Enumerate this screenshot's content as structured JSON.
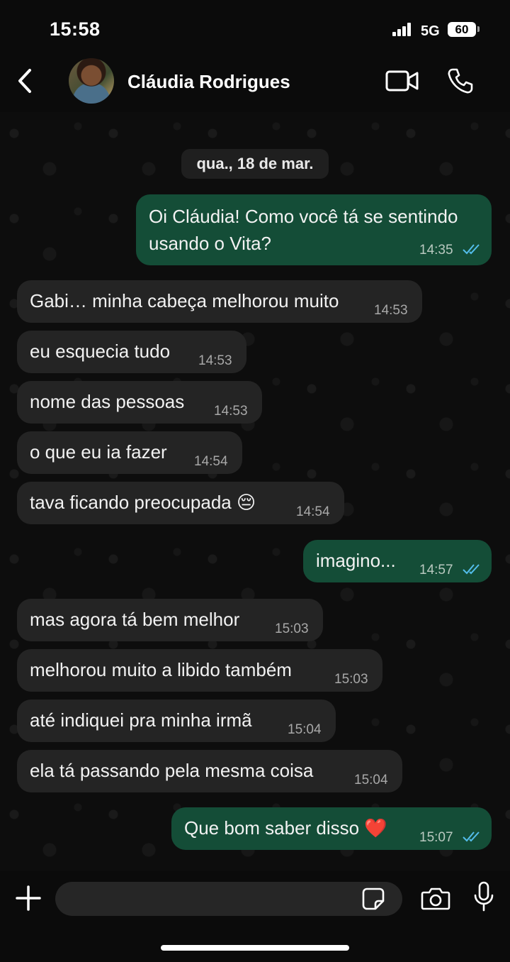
{
  "status": {
    "time": "15:58",
    "network": "5G",
    "battery": "60"
  },
  "header": {
    "contact_name": "Cláudia Rodrigues"
  },
  "chat": {
    "date_separator": "qua., 18 de mar.",
    "messages": [
      {
        "dir": "out",
        "lines": [
          "Oi Cláudia! Como você tá se sentindo",
          "usando o Vita?"
        ],
        "time": "14:35"
      },
      {
        "dir": "in",
        "text": "Gabi… minha cabeça melhorou muito",
        "time": "14:53"
      },
      {
        "dir": "in",
        "text": "eu esquecia tudo",
        "time": "14:53"
      },
      {
        "dir": "in",
        "text": "nome das pessoas",
        "time": "14:53"
      },
      {
        "dir": "in",
        "text": "o que eu ia fazer",
        "time": "14:54"
      },
      {
        "dir": "in",
        "text": "tava ficando preocupada 😔",
        "time": "14:54"
      },
      {
        "dir": "out",
        "text": "imagino...",
        "time": "14:57"
      },
      {
        "dir": "in",
        "text": "mas agora tá bem melhor",
        "time": "15:03"
      },
      {
        "dir": "in",
        "text": "melhorou muito a libido também",
        "time": "15:03"
      },
      {
        "dir": "in",
        "text": "até indiquei pra minha irmã",
        "time": "15:04"
      },
      {
        "dir": "in",
        "text": "ela tá passando pela mesma coisa",
        "time": "15:04"
      },
      {
        "dir": "out",
        "text": "Que bom saber disso ❤️",
        "time": "15:07"
      }
    ]
  },
  "composer": {
    "placeholder": ""
  },
  "colors": {
    "outgoing_bubble": "#144d37",
    "incoming_bubble": "#242424",
    "read_ticks": "#53bdeb"
  }
}
